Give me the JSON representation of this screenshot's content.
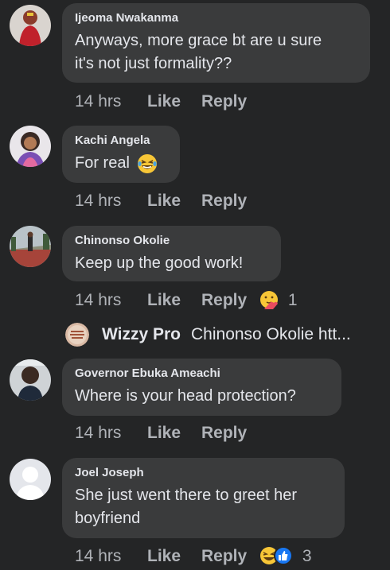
{
  "comments": [
    {
      "author": "Ijeoma Nwakanma",
      "text_lines": [
        "Anyways, more grace bt are u sure",
        "it's not just formality??"
      ],
      "time": "14 hrs",
      "like": "Like",
      "reply": "Reply"
    },
    {
      "author": "Kachi Angela",
      "text": "For real",
      "text_emoji": "laughing-tears-emoji",
      "time": "14 hrs",
      "like": "Like",
      "reply": "Reply"
    },
    {
      "author": "Chinonso Okolie",
      "text": "Keep up the good work!",
      "time": "14 hrs",
      "like": "Like",
      "reply": "Reply",
      "reactions": [
        "care-reaction"
      ],
      "reaction_count": "1"
    },
    {
      "author": "Governor Ebuka Ameachi",
      "text": "Where is your head protection?",
      "time": "14 hrs",
      "like": "Like",
      "reply": "Reply"
    },
    {
      "author": "Joel Joseph",
      "text_lines": [
        "She just went there to greet her",
        "boyfriend"
      ],
      "time": "14 hrs",
      "like": "Like",
      "reply": "Reply",
      "reactions": [
        "haha-reaction",
        "like-reaction"
      ],
      "reaction_count": "3"
    }
  ],
  "reply_preview": {
    "author": "Wizzy Pro",
    "text": "Chinonso Okolie htt..."
  },
  "colors": {
    "background": "#242526",
    "bubble": "#3a3b3c",
    "primary_text": "#e4e6eb",
    "secondary_text": "#b0b3b8",
    "like_blue": "#1877f2",
    "emoji_yellow": "#f7c637"
  }
}
